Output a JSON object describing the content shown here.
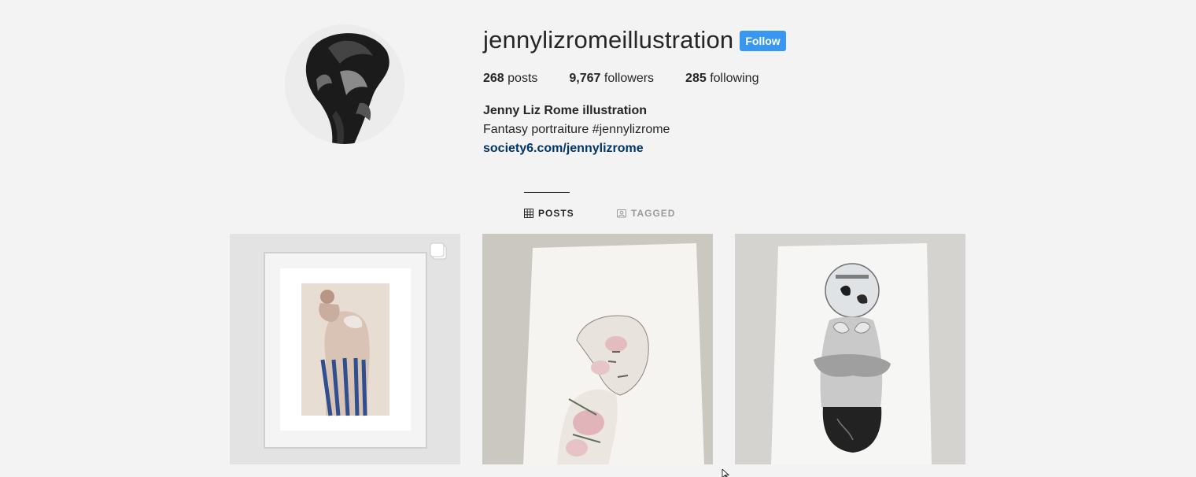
{
  "profile": {
    "username": "jennylizromeillustration",
    "follow_label": "Follow",
    "stats": {
      "posts_count": "268",
      "posts_label": "posts",
      "followers_count": "9,767",
      "followers_label": "followers",
      "following_count": "285",
      "following_label": "following"
    },
    "full_name": "Jenny Liz Rome illustration",
    "bio": "Fantasy portraiture #jennylizrome",
    "website": "society6.com/jennylizrome"
  },
  "tabs": [
    {
      "label": "POSTS",
      "icon": "grid-icon",
      "active": true
    },
    {
      "label": "TAGGED",
      "icon": "tag-icon",
      "active": false
    }
  ],
  "posts": [
    {
      "icon": "framed-print-image",
      "multi": true
    },
    {
      "icon": "floral-portrait-image",
      "multi": false
    },
    {
      "icon": "fishbowl-figure-image",
      "multi": false
    }
  ],
  "colors": {
    "accent": "#3897f0",
    "link": "#003569",
    "background": "#f3f3f3"
  }
}
